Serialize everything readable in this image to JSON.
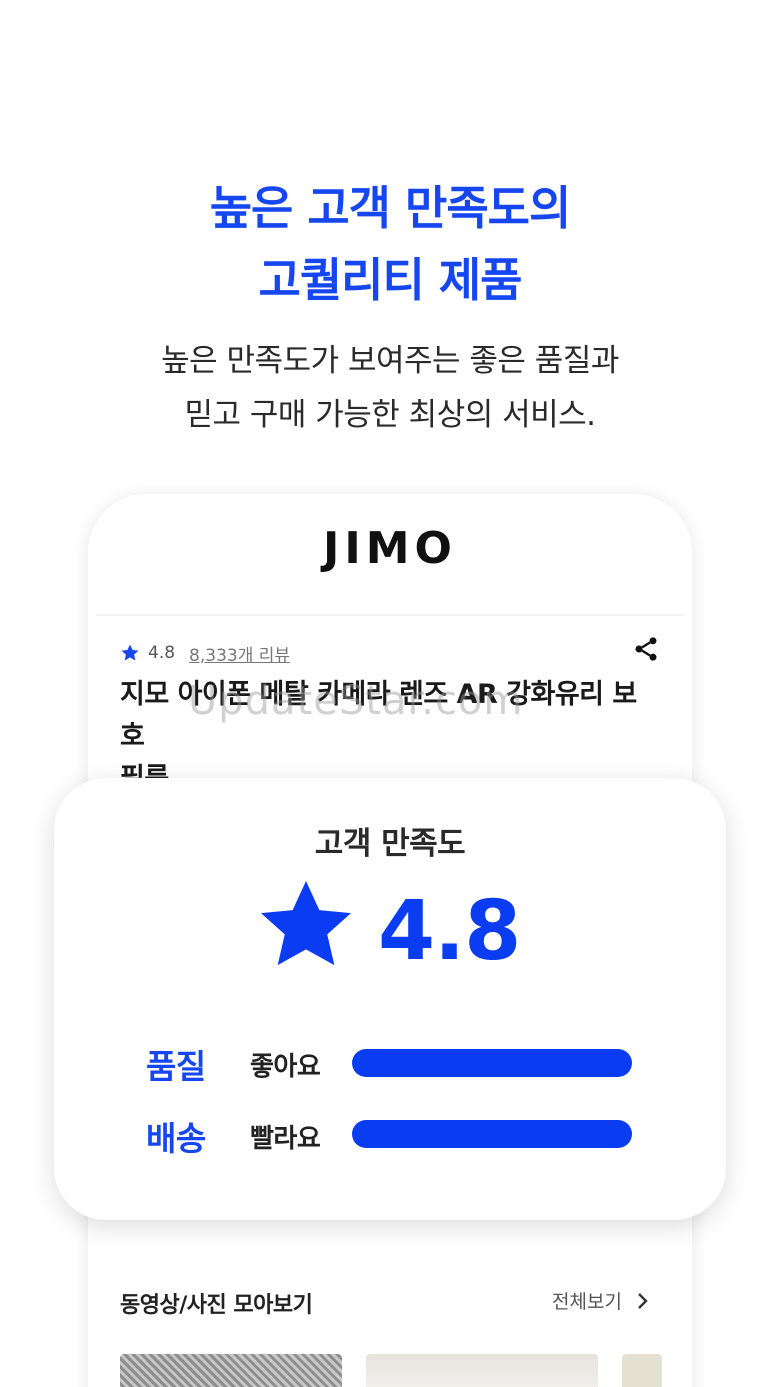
{
  "hero": {
    "headline_line1": "높은 고객 만족도의",
    "headline_line2": "고퀄리티 제품",
    "sub_line1": "높은 만족도가 보여주는 좋은 품질과",
    "sub_line2": "믿고 구매 가능한 최상의 서비스."
  },
  "app": {
    "brand": "JIMO",
    "product": {
      "rating": "4.8",
      "review_count": "8,333개 리뷰",
      "title_line1": "지모 아이폰 메탈 카메라 렌즈 AR 강화유리 보호",
      "title_line2": "필름"
    },
    "watermark": "UpdateStar.com"
  },
  "satisfaction": {
    "title": "고객 만족도",
    "score": "4.8",
    "metrics": [
      {
        "label": "품질",
        "value": "좋아요",
        "level": 1.0
      },
      {
        "label": "배송",
        "value": "빨라요",
        "level": 1.0
      }
    ]
  },
  "gallery": {
    "title": "동영상/사진 모아보기",
    "see_all": "전체보기"
  },
  "colors": {
    "accent": "#1546f0",
    "bar": "#0a3cf2"
  },
  "icons": {
    "star": "star-icon",
    "share": "share-icon",
    "chevron": "chevron-right-icon"
  }
}
